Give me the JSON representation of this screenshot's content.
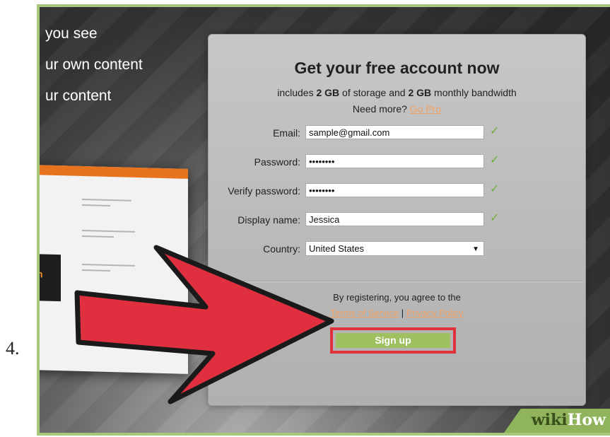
{
  "step_number": "4.",
  "promo_lines": [
    "you see",
    "ur own content",
    "ur content"
  ],
  "screenshot_thumb": {
    "side_text": "n"
  },
  "form": {
    "title": "Get your free account now",
    "subtitle": {
      "pre": "includes ",
      "storage": "2 GB",
      "mid": " of storage and ",
      "bandwidth": "2 GB",
      "post": " monthly bandwidth"
    },
    "need_more": "Need more?",
    "go_pro": "Go Pro",
    "fields": [
      {
        "label": "Email:",
        "value": "sample@gmail.com",
        "valid": true
      },
      {
        "label": "Password:",
        "value": "••••••••",
        "valid": true
      },
      {
        "label": "Verify password:",
        "value": "••••••••",
        "valid": true
      },
      {
        "label": "Display name:",
        "value": "Jessica",
        "valid": true
      }
    ],
    "country": {
      "label": "Country:",
      "value": "United States"
    },
    "agree_text": "By registering, you agree to the",
    "terms_link": "Terms of Service",
    "separator": "|",
    "privacy_link": "Privacy Policy",
    "signup_label": "Sign up"
  },
  "colors": {
    "accent_link": "#f3a062",
    "signup_button": "#9ec060",
    "highlight": "#e1313b",
    "arrow": "#e03040",
    "check": "#6fae3c"
  },
  "icons": {
    "valid": "check-icon",
    "dropdown": "triangle-down-icon",
    "pointer": "red-arrow-icon"
  },
  "watermark": {
    "wiki": "wiki",
    "how": "How"
  }
}
